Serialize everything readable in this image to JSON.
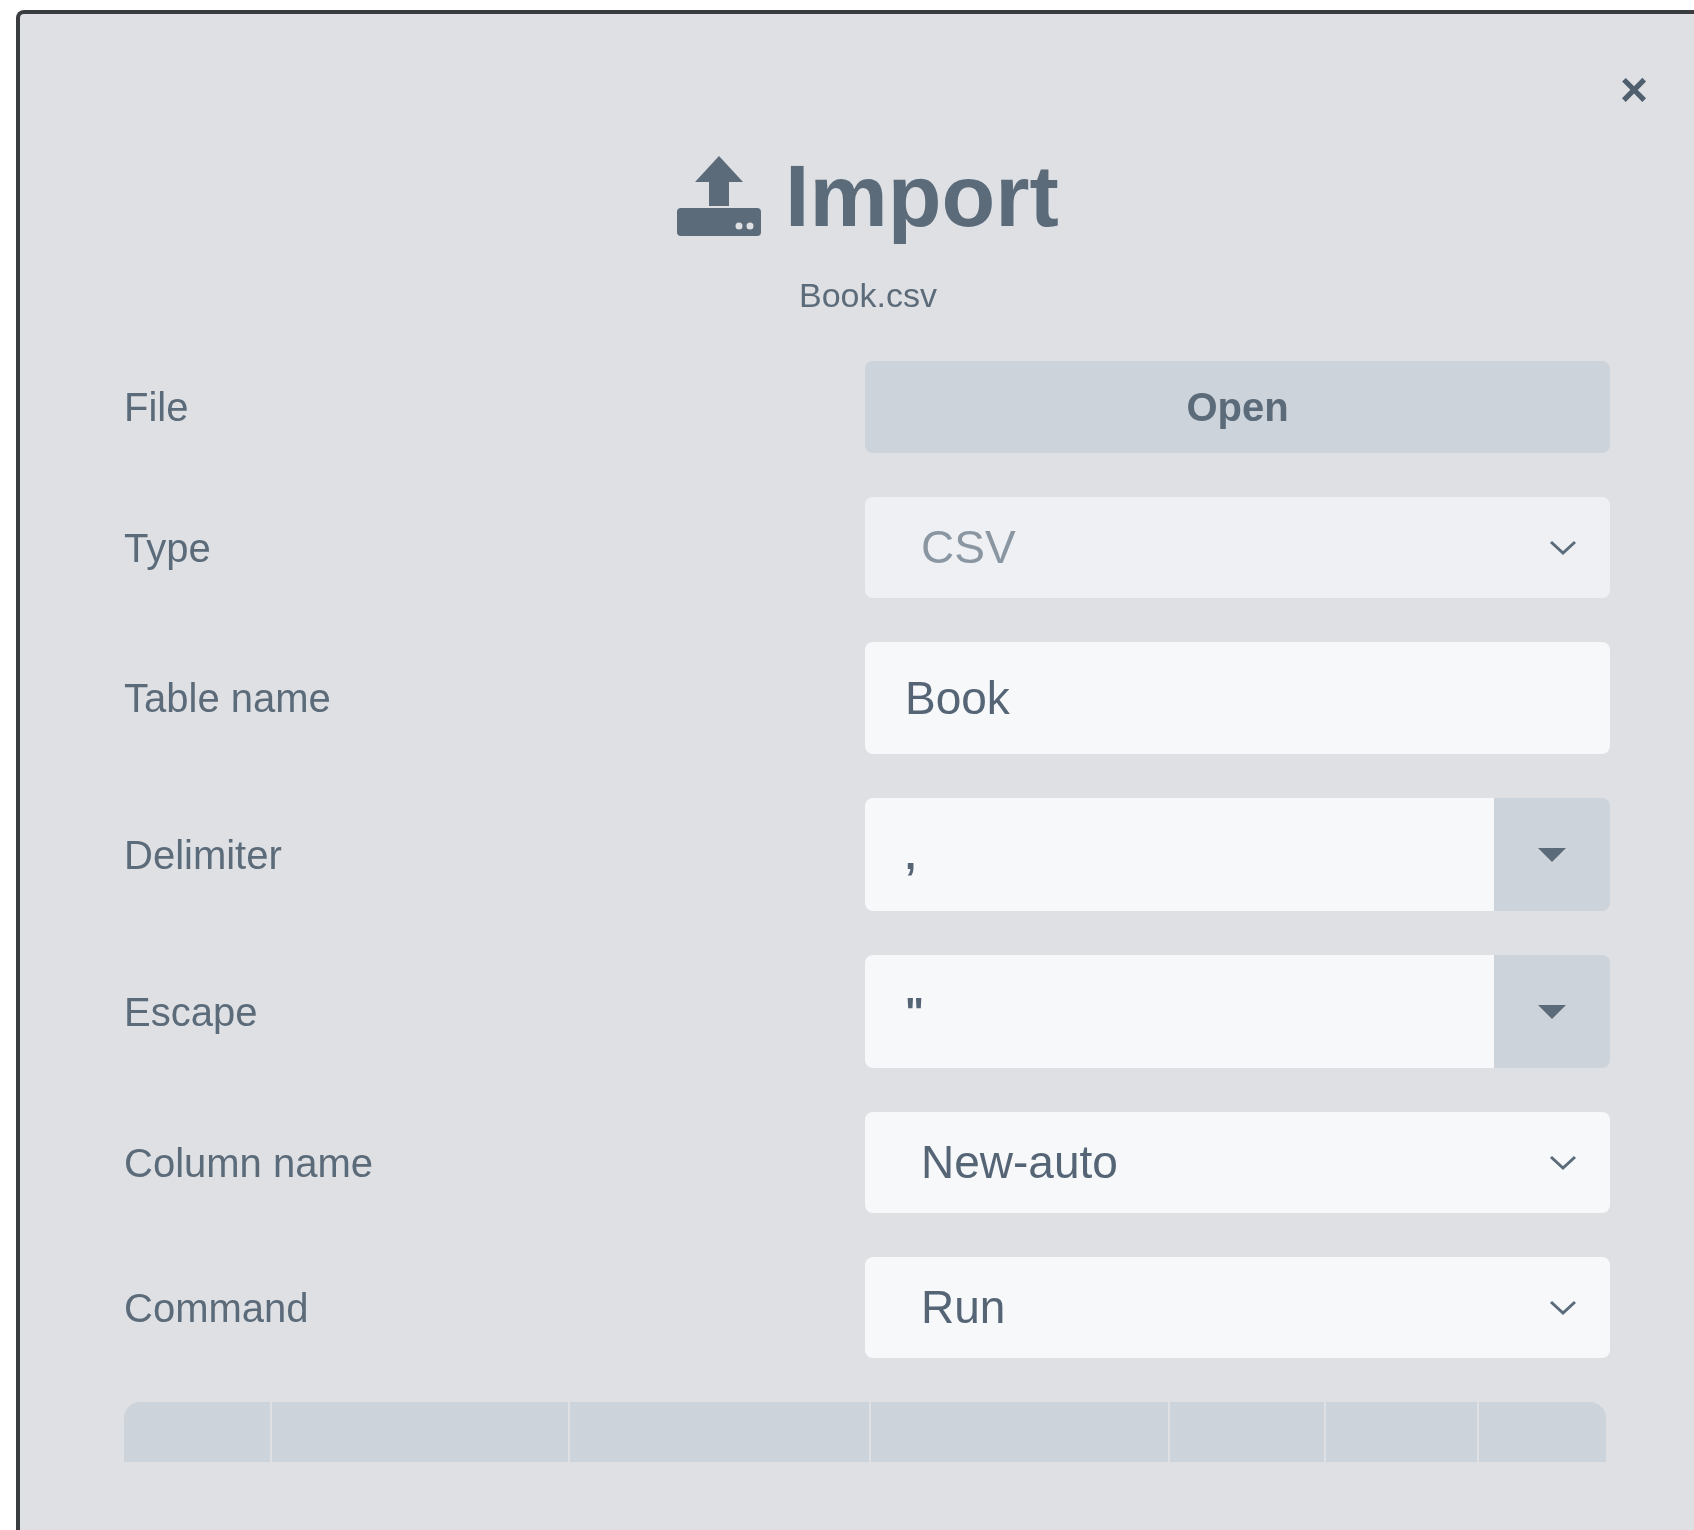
{
  "dialog": {
    "title": "Import",
    "subtitle": "Book.csv",
    "close": "×",
    "fields": [
      {
        "label": "File",
        "kind": "button",
        "value": "Open"
      },
      {
        "label": "Type",
        "kind": "select",
        "value": "CSV",
        "disabled": true
      },
      {
        "label": "Table name",
        "kind": "input",
        "value": "Book"
      },
      {
        "label": "Delimiter",
        "kind": "combo",
        "value": ","
      },
      {
        "label": "Escape",
        "kind": "combo",
        "value": "\""
      },
      {
        "label": "Column name",
        "kind": "select",
        "value": "New-auto",
        "disabled": false
      },
      {
        "label": "Command",
        "kind": "select",
        "value": "Run",
        "disabled": false
      }
    ]
  }
}
